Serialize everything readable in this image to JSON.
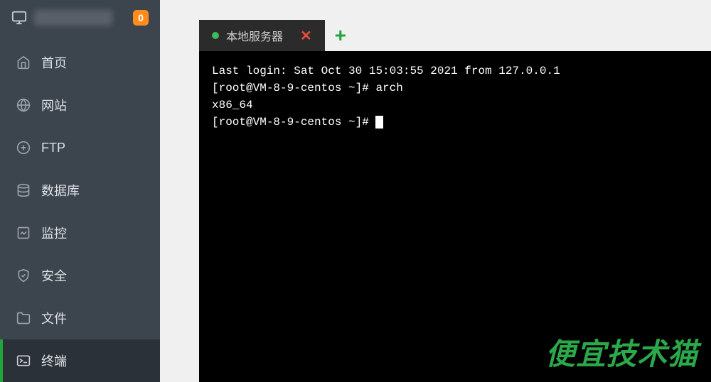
{
  "header": {
    "badge_count": "0"
  },
  "sidebar": {
    "items": [
      {
        "label": "首页",
        "icon": "home"
      },
      {
        "label": "网站",
        "icon": "globe"
      },
      {
        "label": "FTP",
        "icon": "ftp"
      },
      {
        "label": "数据库",
        "icon": "database"
      },
      {
        "label": "监控",
        "icon": "monitor"
      },
      {
        "label": "安全",
        "icon": "shield"
      },
      {
        "label": "文件",
        "icon": "folder"
      },
      {
        "label": "终端",
        "icon": "terminal"
      }
    ],
    "active_index": 7
  },
  "tabs": {
    "active": {
      "label": "本地服务器"
    }
  },
  "terminal": {
    "line1": "Last login: Sat Oct 30 15:03:55 2021 from 127.0.0.1",
    "line2": "[root@VM-8-9-centos ~]# arch",
    "line3": "x86_64",
    "line4_prompt": "[root@VM-8-9-centos ~]# "
  },
  "watermark": "便宜技术猫"
}
